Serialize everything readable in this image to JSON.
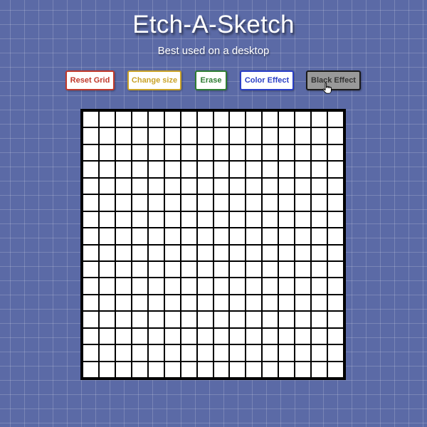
{
  "header": {
    "title": "Etch-A-Sketch",
    "subtitle": "Best used on a desktop"
  },
  "toolbar": {
    "reset_label": "Reset Grid",
    "size_label": "Change size",
    "erase_label": "Erase",
    "color_label": "Color Effect",
    "black_label": "Black Effect"
  },
  "grid": {
    "rows": 16,
    "columns": 16
  },
  "colors": {
    "background": "#5b6aa6",
    "reset": "#c0392b",
    "size": "#c9a227",
    "erase": "#2e7d32",
    "color_effect": "#2a3fc6",
    "black_effect_active": "#999999"
  },
  "icons": {
    "cursor": "hand-pointer-icon"
  }
}
